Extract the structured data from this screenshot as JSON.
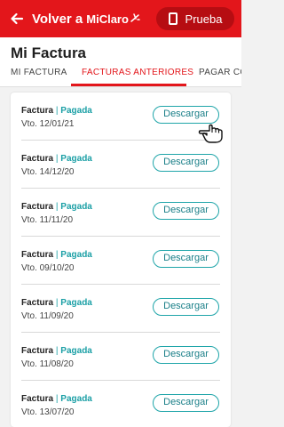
{
  "topbar": {
    "back_label": "Volver a",
    "brand": "MiClaro",
    "action_label": "Prueba",
    "accent": "#e3161b"
  },
  "page": {
    "title": "Mi Factura"
  },
  "tabs": [
    {
      "label": "MI FACTURA",
      "active": false
    },
    {
      "label": "FACTURAS ANTERIORES",
      "active": true
    },
    {
      "label": "PAGAR CO",
      "active": false
    }
  ],
  "invoices": [
    {
      "label": "Factura",
      "separator": "|",
      "status": "Pagada",
      "due": "Vto. 12/01/21",
      "action": "Descargar"
    },
    {
      "label": "Factura",
      "separator": "|",
      "status": "Pagada",
      "due": "Vto. 14/12/20",
      "action": "Descargar"
    },
    {
      "label": "Factura",
      "separator": "|",
      "status": "Pagada",
      "due": "Vto. 11/11/20",
      "action": "Descargar"
    },
    {
      "label": "Factura",
      "separator": "|",
      "status": "Pagada",
      "due": "Vto. 09/10/20",
      "action": "Descargar"
    },
    {
      "label": "Factura",
      "separator": "|",
      "status": "Pagada",
      "due": "Vto. 11/09/20",
      "action": "Descargar"
    },
    {
      "label": "Factura",
      "separator": "|",
      "status": "Pagada",
      "due": "Vto. 11/08/20",
      "action": "Descargar"
    },
    {
      "label": "Factura",
      "separator": "|",
      "status": "Pagada",
      "due": "Vto. 13/07/20",
      "action": "Descargar"
    }
  ]
}
